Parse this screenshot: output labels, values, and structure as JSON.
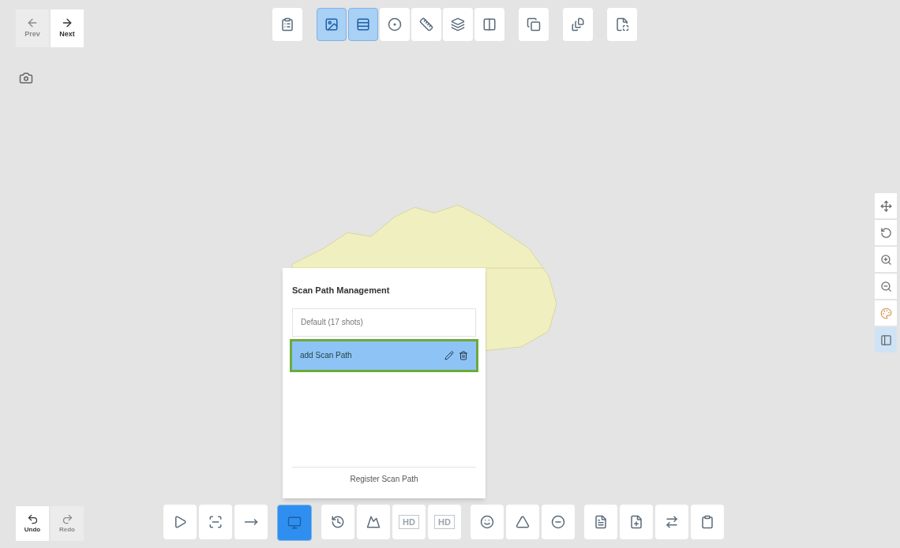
{
  "nav": [
    {
      "label": "Prev",
      "disabled": true
    },
    {
      "label": "Next",
      "disabled": false
    }
  ],
  "top_toolbar": {
    "groups": [
      [
        {
          "selected": false
        }
      ],
      [
        {
          "selected": true
        },
        {
          "selected": true
        },
        {
          "selected": false
        },
        {
          "selected": false
        },
        {
          "selected": false
        },
        {
          "selected": false
        }
      ],
      [
        {
          "selected": false
        }
      ],
      [
        {
          "selected": false
        }
      ],
      [
        {
          "selected": false
        }
      ]
    ]
  },
  "scan_path_panel": {
    "title": "Scan Path Management",
    "items": [
      {
        "label": "Default (17 shots)",
        "selected": false
      },
      {
        "label": "add Scan Path",
        "selected": true
      }
    ],
    "register_button": "Register Scan Path"
  },
  "history": [
    {
      "label": "Undo",
      "disabled": false
    },
    {
      "label": "Redo",
      "disabled": true
    }
  ],
  "bottom_toolbar": {
    "groups": [
      [
        {
          "selected": false
        },
        {
          "selected": false
        },
        {
          "selected": false
        }
      ],
      [
        {
          "selected": true
        }
      ],
      [
        {
          "selected": false
        },
        {
          "selected": false
        },
        {
          "selected": false,
          "label": "HD"
        },
        {
          "selected": false,
          "label": "HD"
        }
      ],
      [
        {
          "selected": false
        },
        {
          "selected": false
        },
        {
          "selected": false
        }
      ],
      [
        {
          "selected": false
        },
        {
          "selected": false
        },
        {
          "selected": false
        },
        {
          "selected": false
        }
      ]
    ]
  }
}
